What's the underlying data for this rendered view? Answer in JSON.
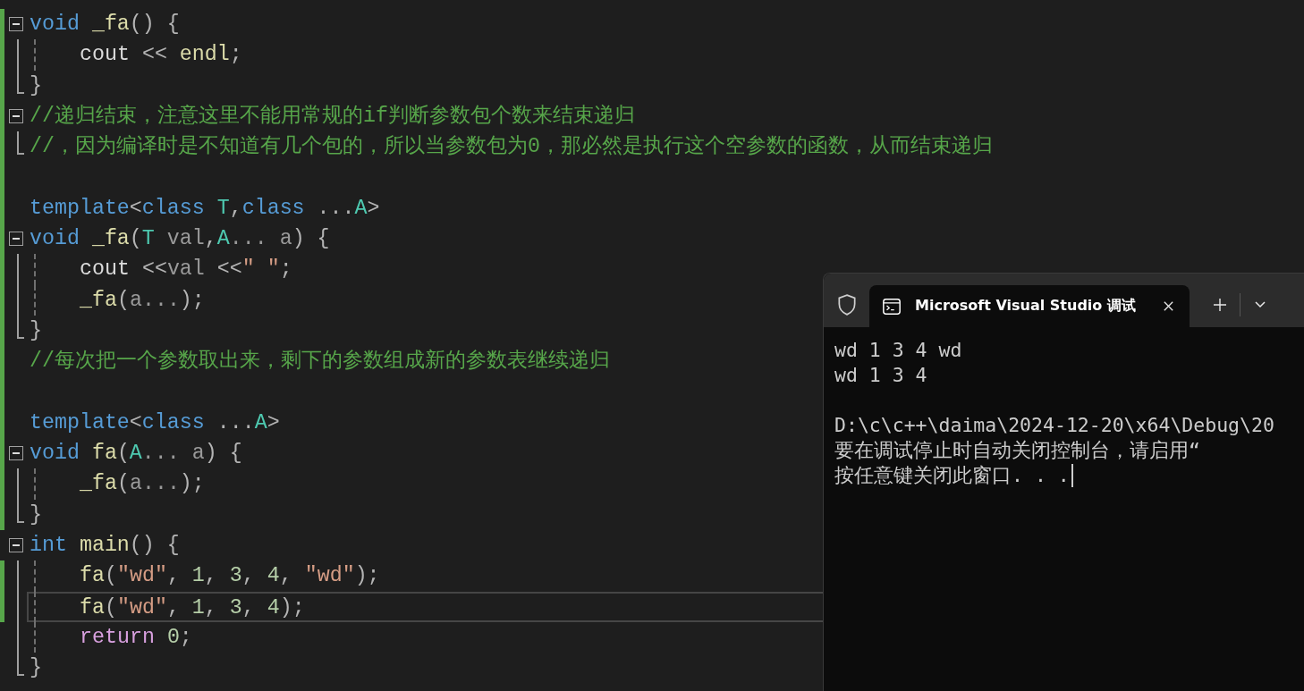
{
  "editor": {
    "lines": [
      {
        "kind": "fold-start",
        "guide": false,
        "changed": true,
        "current": false,
        "tokens": [
          {
            "text": "void ",
            "kind": "kw"
          },
          {
            "text": "_fa",
            "kind": "fn"
          },
          {
            "text": "() {",
            "kind": "pu"
          }
        ]
      },
      {
        "kind": "fold-body",
        "guide": true,
        "changed": true,
        "current": false,
        "tokens": [
          {
            "text": "cout",
            "kind": "pl"
          },
          {
            "text": " << ",
            "kind": "pu"
          },
          {
            "text": "endl",
            "kind": "fn"
          },
          {
            "text": ";",
            "kind": "pu"
          }
        ]
      },
      {
        "kind": "fold-end",
        "guide": false,
        "changed": true,
        "current": false,
        "tokens": [
          {
            "text": "}",
            "kind": "pu"
          }
        ]
      },
      {
        "kind": "fold-start",
        "guide": false,
        "changed": true,
        "current": false,
        "tokens": [
          {
            "text": "//递归结束，注意这里不能用常规的if判断参数包个数来结束递归",
            "kind": "cm"
          }
        ]
      },
      {
        "kind": "fold-end",
        "guide": false,
        "changed": true,
        "current": false,
        "tokens": [
          {
            "text": "//，因为编译时是不知道有几个包的，所以当参数包为0，那必然是执行这个空参数的函数，从而结束递归",
            "kind": "cm"
          }
        ]
      },
      {
        "kind": "plain",
        "guide": false,
        "changed": true,
        "current": false
      },
      {
        "kind": "plain",
        "guide": false,
        "changed": true,
        "current": false,
        "tokens": [
          {
            "text": "template",
            "kind": "kw"
          },
          {
            "text": "<",
            "kind": "pu"
          },
          {
            "text": "class ",
            "kind": "kw"
          },
          {
            "text": "T",
            "kind": "ty"
          },
          {
            "text": ",",
            "kind": "pu"
          },
          {
            "text": "class",
            "kind": "kw"
          },
          {
            "text": " ...",
            "kind": "pu"
          },
          {
            "text": "A",
            "kind": "ty"
          },
          {
            "text": ">",
            "kind": "pu"
          }
        ]
      },
      {
        "kind": "fold-start",
        "guide": false,
        "changed": true,
        "current": false,
        "tokens": [
          {
            "text": "void ",
            "kind": "kw"
          },
          {
            "text": "_fa",
            "kind": "fn"
          },
          {
            "text": "(",
            "kind": "pu"
          },
          {
            "text": "T",
            "kind": "ty"
          },
          {
            "text": " val",
            "kind": "pa"
          },
          {
            "text": ",",
            "kind": "pu"
          },
          {
            "text": "A",
            "kind": "ty"
          },
          {
            "text": "... a",
            "kind": "pa"
          },
          {
            "text": ") {",
            "kind": "pu"
          }
        ]
      },
      {
        "kind": "fold-body",
        "guide": true,
        "changed": true,
        "current": false,
        "tokens": [
          {
            "text": "cout",
            "kind": "pl"
          },
          {
            "text": " <<",
            "kind": "pu"
          },
          {
            "text": "val",
            "kind": "pa"
          },
          {
            "text": " <<",
            "kind": "pu"
          },
          {
            "text": "\" \"",
            "kind": "st"
          },
          {
            "text": ";",
            "kind": "pu"
          }
        ]
      },
      {
        "kind": "fold-body",
        "guide": true,
        "changed": true,
        "current": false,
        "tokens": [
          {
            "text": "_fa",
            "kind": "fn"
          },
          {
            "text": "(",
            "kind": "pu"
          },
          {
            "text": "a...",
            "kind": "pa"
          },
          {
            "text": ");",
            "kind": "pu"
          }
        ]
      },
      {
        "kind": "fold-end",
        "guide": false,
        "changed": true,
        "current": false,
        "tokens": [
          {
            "text": "}",
            "kind": "pu"
          }
        ]
      },
      {
        "kind": "plain",
        "guide": false,
        "changed": true,
        "current": false,
        "tokens": [
          {
            "text": "//每次把一个参数取出来，剩下的参数组成新的参数表继续递归",
            "kind": "cm"
          }
        ]
      },
      {
        "kind": "plain",
        "guide": false,
        "changed": true,
        "current": false
      },
      {
        "kind": "plain",
        "guide": false,
        "changed": true,
        "current": false,
        "tokens": [
          {
            "text": "template",
            "kind": "kw"
          },
          {
            "text": "<",
            "kind": "pu"
          },
          {
            "text": "class",
            "kind": "kw"
          },
          {
            "text": " ...",
            "kind": "pu"
          },
          {
            "text": "A",
            "kind": "ty"
          },
          {
            "text": ">",
            "kind": "pu"
          }
        ]
      },
      {
        "kind": "fold-start",
        "guide": false,
        "changed": true,
        "current": false,
        "tokens": [
          {
            "text": "void ",
            "kind": "kw"
          },
          {
            "text": "fa",
            "kind": "fn"
          },
          {
            "text": "(",
            "kind": "pu"
          },
          {
            "text": "A",
            "kind": "ty"
          },
          {
            "text": "... a",
            "kind": "pa"
          },
          {
            "text": ") {",
            "kind": "pu"
          }
        ]
      },
      {
        "kind": "fold-body",
        "guide": true,
        "changed": true,
        "current": false,
        "tokens": [
          {
            "text": "_fa",
            "kind": "fn"
          },
          {
            "text": "(",
            "kind": "pu"
          },
          {
            "text": "a...",
            "kind": "pa"
          },
          {
            "text": ");",
            "kind": "pu"
          }
        ]
      },
      {
        "kind": "fold-end",
        "guide": false,
        "changed": true,
        "current": false,
        "tokens": [
          {
            "text": "}",
            "kind": "pu"
          }
        ]
      },
      {
        "kind": "fold-start",
        "guide": false,
        "changed": false,
        "current": false,
        "tokens": [
          {
            "text": "int ",
            "kind": "kw"
          },
          {
            "text": "main",
            "kind": "fn"
          },
          {
            "text": "() {",
            "kind": "pu"
          }
        ]
      },
      {
        "kind": "fold-body",
        "guide": true,
        "changed": true,
        "current": false,
        "tokens": [
          {
            "text": "fa",
            "kind": "fn"
          },
          {
            "text": "(",
            "kind": "pu"
          },
          {
            "text": "\"wd\"",
            "kind": "st"
          },
          {
            "text": ", ",
            "kind": "pu"
          },
          {
            "text": "1",
            "kind": "nu"
          },
          {
            "text": ", ",
            "kind": "pu"
          },
          {
            "text": "3",
            "kind": "nu"
          },
          {
            "text": ", ",
            "kind": "pu"
          },
          {
            "text": "4",
            "kind": "nu"
          },
          {
            "text": ", ",
            "kind": "pu"
          },
          {
            "text": "\"wd\"",
            "kind": "st"
          },
          {
            "text": ");",
            "kind": "pu"
          }
        ]
      },
      {
        "kind": "fold-body",
        "guide": true,
        "changed": true,
        "current": true,
        "tokens": [
          {
            "text": "fa",
            "kind": "fn"
          },
          {
            "text": "(",
            "kind": "pu"
          },
          {
            "text": "\"wd\"",
            "kind": "st"
          },
          {
            "text": ", ",
            "kind": "pu"
          },
          {
            "text": "1",
            "kind": "nu"
          },
          {
            "text": ", ",
            "kind": "pu"
          },
          {
            "text": "3",
            "kind": "nu"
          },
          {
            "text": ", ",
            "kind": "pu"
          },
          {
            "text": "4",
            "kind": "nu"
          },
          {
            "text": ");",
            "kind": "pu"
          }
        ]
      },
      {
        "kind": "fold-body",
        "guide": true,
        "changed": false,
        "current": false,
        "tokens": [
          {
            "text": "return ",
            "kind": "ct"
          },
          {
            "text": "0",
            "kind": "nu"
          },
          {
            "text": ";",
            "kind": "pu"
          }
        ]
      },
      {
        "kind": "fold-end",
        "guide": false,
        "changed": false,
        "current": false,
        "tokens": [
          {
            "text": "}",
            "kind": "pu"
          }
        ]
      }
    ]
  },
  "terminal": {
    "tab_title": "Microsoft Visual Studio 调试",
    "output_blocks": [
      [
        "wd 1 3 4 wd",
        "wd 1 3 4"
      ],
      [
        "D:\\c\\c++\\daima\\2024-12-20\\x64\\Debug\\20",
        "要在调试停止时自动关闭控制台，请启用“",
        "按任意键关闭此窗口. . ."
      ]
    ],
    "cursor": true
  }
}
